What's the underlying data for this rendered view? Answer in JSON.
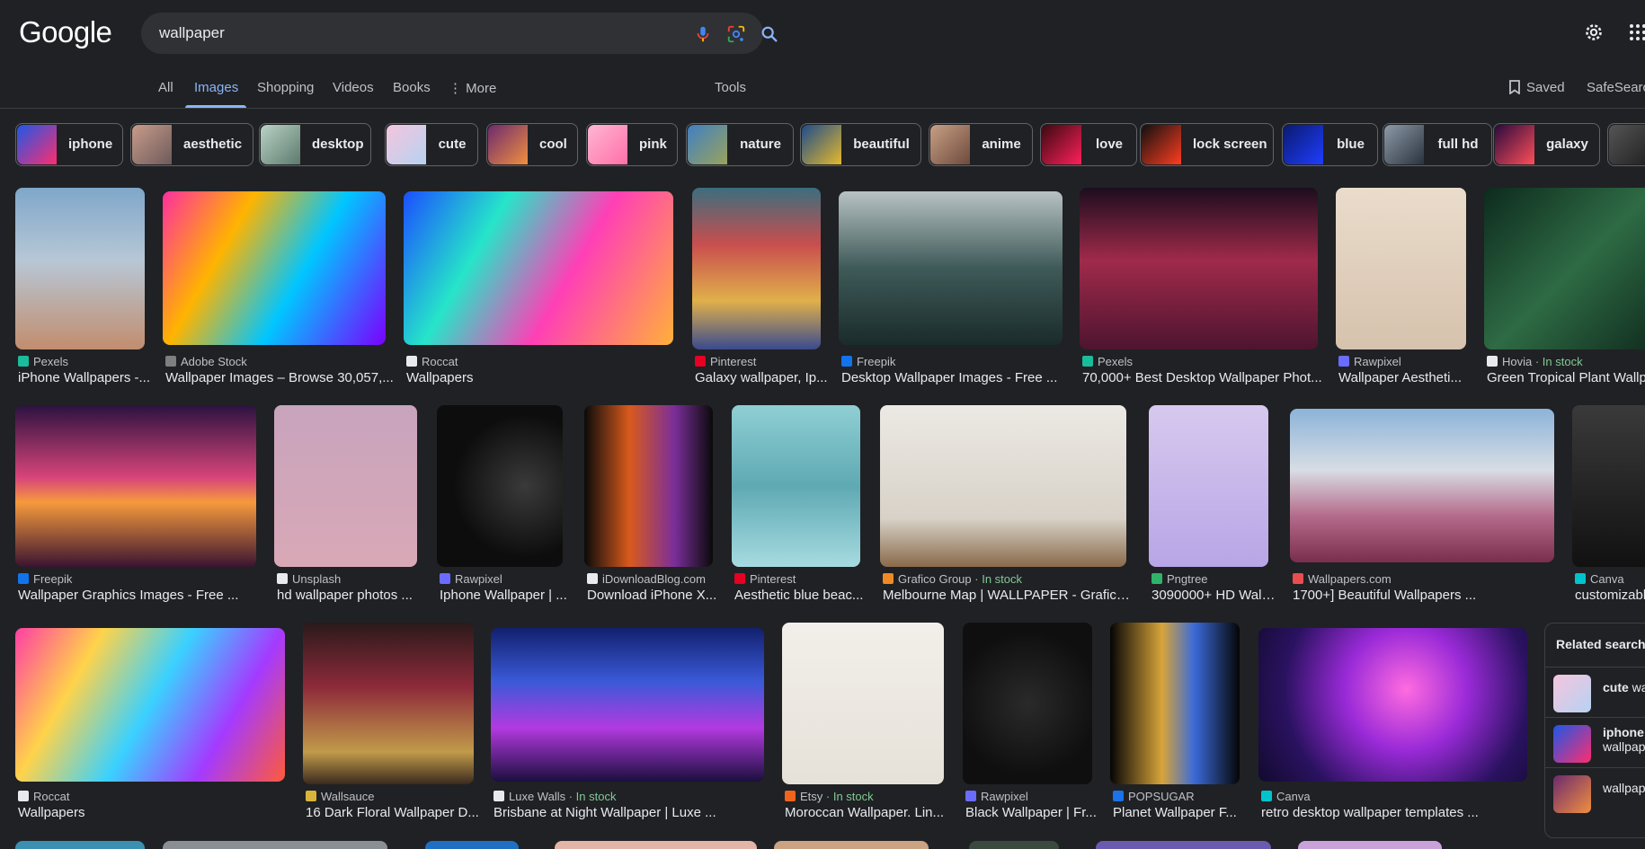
{
  "header": {
    "logo_text": "Google",
    "search_value": "wallpaper",
    "icons": [
      "mic-icon",
      "lens-icon",
      "search-icon",
      "gear-icon",
      "apps-grid-icon"
    ]
  },
  "tabs": {
    "items": [
      "All",
      "Images",
      "Shopping",
      "Videos",
      "Books",
      "More"
    ],
    "active": "Images",
    "more_prefix": "⋮",
    "tools": "Tools",
    "saved": "Saved",
    "safesearch": "SafeSearch"
  },
  "chips": [
    {
      "label": "iphone",
      "color_a": "#1c58e8",
      "color_b": "#ff2d6f"
    },
    {
      "label": "aesthetic",
      "color_a": "#c89c8a",
      "color_b": "#6e5a5a"
    },
    {
      "label": "desktop",
      "color_a": "#b9d3c6",
      "color_b": "#5d7a6e"
    },
    {
      "label": "cute",
      "color_a": "#f5c5dd",
      "color_b": "#b6d2f2"
    },
    {
      "label": "cool",
      "color_a": "#6c2a6e",
      "color_b": "#f18f3f"
    },
    {
      "label": "pink",
      "color_a": "#ffb6d5",
      "color_b": "#ff6fa7"
    },
    {
      "label": "nature",
      "color_a": "#3f7fc2",
      "color_b": "#9aa35c"
    },
    {
      "label": "beautiful",
      "color_a": "#1e4b8c",
      "color_b": "#e4b92c"
    },
    {
      "label": "anime",
      "color_a": "#c7a084",
      "color_b": "#6e4a3d"
    },
    {
      "label": "love",
      "color_a": "#3a0a10",
      "color_b": "#ff1f5a"
    },
    {
      "label": "lock screen",
      "color_a": "#101010",
      "color_b": "#ff3d20"
    },
    {
      "label": "blue",
      "color_a": "#0a1a6e",
      "color_b": "#1f3dff"
    },
    {
      "label": "full hd",
      "color_a": "#8d9aa8",
      "color_b": "#2a333d"
    },
    {
      "label": "galaxy",
      "color_a": "#2a0a3e",
      "color_b": "#ff4e58"
    }
  ],
  "rows": [
    [
      {
        "source": "Pexels",
        "title": "iPhone Wallpapers -...",
        "fav": "#1abc9c",
        "in_stock": "",
        "bg": "linear-gradient(180deg,#7fa7c9 0%,#b7c7d6 45%,#c28d6e 100%)"
      },
      {
        "source": "Adobe Stock",
        "title": "Wallpaper Images – Browse 30,057,...",
        "fav": "#7f7f7f",
        "in_stock": "",
        "bg": "linear-gradient(120deg,#ff2f9e 0%,#ffb400 30%,#00c6ff 60%,#7a00ff 100%)"
      },
      {
        "source": "Roccat",
        "title": "Wallpapers",
        "fav": "#e8eaed",
        "in_stock": "",
        "bg": "linear-gradient(120deg,#1b4fff 0%,#26e5c9 30%,#ff3fb6 60%,#ffb03a 100%)"
      },
      {
        "source": "Pinterest",
        "title": "Galaxy wallpaper, Ip...",
        "fav": "#e60023",
        "in_stock": "",
        "bg": "linear-gradient(180deg,#3b6e7e 0%,#c94e4e 35%,#e0b04a 70%,#3a4a8e 100%)"
      },
      {
        "source": "Freepik",
        "title": "Desktop Wallpaper Images - Free ...",
        "fav": "#1273eb",
        "in_stock": "",
        "bg": "linear-gradient(180deg,#b8c2c4 0%,#3e5a58 50%,#1a2b2b 100%)"
      },
      {
        "source": "Pexels",
        "title": "70,000+ Best Desktop Wallpaper Phot...",
        "fav": "#1abc9c",
        "in_stock": "",
        "bg": "linear-gradient(180deg,#1c0d1e 0%,#a02a4a 45%,#4e1430 100%)"
      },
      {
        "source": "Rawpixel",
        "title": "Wallpaper Aestheti...",
        "fav": "#6a6cff",
        "in_stock": "",
        "bg": "linear-gradient(180deg,#eadccb 0%,#d6c2ad 100%)"
      },
      {
        "source": "Hovia",
        "title": "Green Tropical Plant Wallpaper",
        "fav": "#e8eaed",
        "in_stock": "In stock",
        "bg": "linear-gradient(135deg,#0d2b1e 0%,#2e6b44 50%,#0f2a1d 100%)"
      }
    ],
    [
      {
        "source": "Freepik",
        "title": "Wallpaper Graphics Images - Free ...",
        "fav": "#1273eb",
        "in_stock": "",
        "bg": "linear-gradient(180deg,#2b1240 0%,#d8457a 45%,#f69a3d 60%,#3a1430 100%)"
      },
      {
        "source": "Unsplash",
        "title": "hd wallpaper photos ...",
        "fav": "#e8eaed",
        "in_stock": "",
        "bg": "linear-gradient(180deg,#c8a4bd 0%,#d9a8b6 100%)"
      },
      {
        "source": "Rawpixel",
        "title": "Iphone Wallpaper | ...",
        "fav": "#6a6cff",
        "in_stock": "",
        "bg": "radial-gradient(circle at 70% 50%,#3a3a3a 0%,#0d0d0d 60%)"
      },
      {
        "source": "iDownloadBlog.com",
        "title": "Download iPhone X...",
        "fav": "#e8eaed",
        "in_stock": "",
        "bg": "linear-gradient(90deg,#0a0a0a 0%,#d85a1c 35%,#7b2e9a 70%,#0a0a0a 100%)"
      },
      {
        "source": "Pinterest",
        "title": "Aesthetic blue beac...",
        "fav": "#e60023",
        "in_stock": "",
        "bg": "linear-gradient(180deg,#8fcfd3 0%,#5fa9b3 50%,#a6dbe0 100%)"
      },
      {
        "source": "Grafico Group",
        "title": "Melbourne Map | WALLPAPER - Grafico ...",
        "fav": "#f08a24",
        "in_stock": "In stock",
        "bg": "linear-gradient(180deg,#ece9e4 0%,#d8d2c8 70%,#8a6a4a 100%)"
      },
      {
        "source": "Pngtree",
        "title": "3090000+ HD Wallp...",
        "fav": "#2fb36b",
        "in_stock": "",
        "bg": "linear-gradient(180deg,#d6c9ee 0%,#b8a5e6 100%)"
      },
      {
        "source": "Wallpapers.com",
        "title": "1700+] Beautiful Wallpapers ...",
        "fav": "#e84e4e",
        "in_stock": "",
        "bg": "linear-gradient(180deg,#8cb3d9 0%,#d8dde4 40%,#b46a8a 70%,#7a2e4e 100%)"
      },
      {
        "source": "Canva",
        "title": "customizable wallpaper",
        "fav": "#00c4cc",
        "in_stock": "",
        "bg": "linear-gradient(180deg,#3a3a3a 0%,#111 100%)"
      }
    ],
    [
      {
        "source": "Roccat",
        "title": "Wallpapers",
        "fav": "#e8eaed",
        "in_stock": "",
        "bg": "linear-gradient(120deg,#ff3fa3 0%,#ffd34a 25%,#3ad1ff 50%,#a43aff 75%,#ff5a3a 100%)"
      },
      {
        "source": "Wallsauce",
        "title": "16 Dark Floral Wallpaper D...",
        "fav": "#d9b43a",
        "in_stock": "",
        "bg": "linear-gradient(180deg,#2a1a1a 0%,#8e2a3a 40%,#c19a4a 80%,#3a2a1e 100%)"
      },
      {
        "source": "Luxe Walls",
        "title": "Brisbane at Night Wallpaper | Luxe ...",
        "fav": "#e8eaed",
        "in_stock": "In stock",
        "bg": "linear-gradient(180deg,#12206e 0%,#3a5ad8 35%,#b23ae0 65%,#1b0f3e 100%)"
      },
      {
        "source": "Etsy",
        "title": "Moroccan Wallpaper. Lin...",
        "fav": "#f1641e",
        "in_stock": "In stock",
        "bg": "linear-gradient(180deg,#f2efea 0%,#e6e1d8 100%)"
      },
      {
        "source": "Rawpixel",
        "title": "Black Wallpaper | Fr...",
        "fav": "#6a6cff",
        "in_stock": "",
        "bg": "radial-gradient(circle at 50% 50%,#2a2a2a 0%,#0f0f0f 70%)"
      },
      {
        "source": "POPSUGAR",
        "title": "Planet Wallpaper F...",
        "fav": "#1a73e8",
        "in_stock": "",
        "bg": "linear-gradient(90deg,#050505 0%,#d8a43a 40%,#3a6ad8 65%,#050505 100%)"
      },
      {
        "source": "Canva",
        "title": "retro desktop wallpaper templates ...",
        "fav": "#00c4cc",
        "in_stock": "",
        "bg": "radial-gradient(circle at 55% 40%,#ff6be0 0%,#9a2ad8 35%,#2a1260 70%,#120a2e 100%)"
      }
    ]
  ],
  "related": {
    "heading": "Related searches",
    "items": [
      {
        "bold": "cute",
        "rest": " wallpaper",
        "thumb": "linear-gradient(135deg,#f5c5dd,#b6d2f2)"
      },
      {
        "bold": "iphone",
        "rest": "wallpaper",
        "thumb": "linear-gradient(135deg,#1c58e8,#ff2d6f)"
      },
      {
        "bold": "",
        "rest": "wallpaper",
        "thumb": "linear-gradient(135deg,#6c2a6e,#f18f3f)"
      }
    ]
  }
}
